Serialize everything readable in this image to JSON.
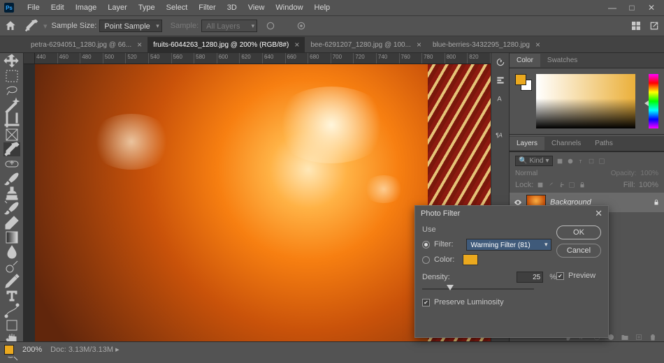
{
  "app": {
    "logo_text": "Ps"
  },
  "menu": [
    "File",
    "Edit",
    "Image",
    "Layer",
    "Type",
    "Select",
    "Filter",
    "3D",
    "View",
    "Window",
    "Help"
  ],
  "window_ctrls": {
    "min": "—",
    "max": "□",
    "close": "✕"
  },
  "options": {
    "sample_size_label": "Sample Size:",
    "sample_size_value": "Point Sample",
    "sample_label": "Sample:",
    "sample_value": "All Layers"
  },
  "tabs": [
    {
      "label": "petra-6294051_1280.jpg @ 66...",
      "active": false
    },
    {
      "label": "fruits-6044263_1280.jpg @ 200% (RGB/8#)",
      "active": true
    },
    {
      "label": "bee-6291207_1280.jpg @ 100...",
      "active": false
    },
    {
      "label": "blue-berries-3432295_1280.jpg",
      "active": false
    }
  ],
  "ruler_ticks": [
    "440",
    "460",
    "480",
    "500",
    "520",
    "540",
    "560",
    "580",
    "600",
    "620",
    "640",
    "660",
    "680",
    "700",
    "720",
    "740",
    "760",
    "780",
    "800",
    "820"
  ],
  "color_panel": {
    "tab_color": "Color",
    "tab_swatches": "Swatches",
    "fg": "#eba91e",
    "bg": "#ffffff"
  },
  "layers_panel": {
    "tab_layers": "Layers",
    "tab_channels": "Channels",
    "tab_paths": "Paths",
    "kind_label": "Kind",
    "mode": "Normal",
    "opacity_label": "Opacity:",
    "opacity_value": "100%",
    "lock_label": "Lock:",
    "fill_label": "Fill:",
    "fill_value": "100%",
    "layer_name": "Background"
  },
  "status": {
    "fg": "#eba91e",
    "zoom": "200%",
    "doc_label": "Doc:",
    "doc_value": "3.13M/3.13M"
  },
  "dialog": {
    "title": "Photo Filter",
    "use_label": "Use",
    "filter_label": "Filter:",
    "filter_value": "Warming Filter (81)",
    "color_label": "Color:",
    "density_label": "Density:",
    "density_value": "25",
    "density_pct": "%",
    "preserve_label": "Preserve Luminosity",
    "ok": "OK",
    "cancel": "Cancel",
    "preview": "Preview"
  }
}
